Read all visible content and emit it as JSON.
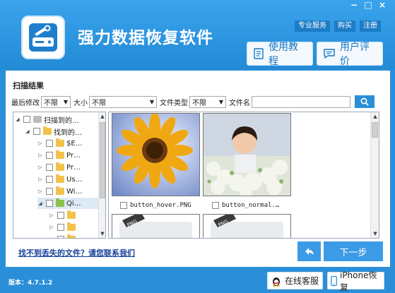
{
  "app": {
    "title": "强力数据恢复软件"
  },
  "window": {
    "minimize": "−",
    "maximize": "□",
    "close": "×"
  },
  "top_links": [
    "专业服务",
    "购买",
    "注册"
  ],
  "header_buttons": {
    "tutorial": "使用教程",
    "review": "用户评价"
  },
  "panel": {
    "title": "扫描结果"
  },
  "filters": {
    "modified_label": "最后修改",
    "modified_value": "不限",
    "size_label": "大小",
    "size_value": "不限",
    "type_label": "文件类型",
    "type_value": "不限",
    "name_label": "文件名",
    "name_value": ""
  },
  "tree": [
    {
      "label": "扫描到的…",
      "icon": "drive"
    },
    {
      "label": "找到的…",
      "icon": "folder"
    },
    {
      "label": "$E…",
      "icon": "folder"
    },
    {
      "label": "Pr…",
      "icon": "folder"
    },
    {
      "label": "Pr…",
      "icon": "folder"
    },
    {
      "label": "Us…",
      "icon": "folder"
    },
    {
      "label": "Wi…",
      "icon": "folder"
    },
    {
      "label": "Qi…",
      "icon": "folder-green"
    },
    {
      "label": "",
      "icon": "folder"
    },
    {
      "label": "",
      "icon": "folder"
    },
    {
      "label": "",
      "icon": "folder"
    },
    {
      "label": "",
      "icon": "folder"
    }
  ],
  "files": [
    {
      "name": "button_hover.PNG",
      "image": "sunflower"
    },
    {
      "name": "button_normal.…",
      "image": "child-photo"
    },
    {
      "name": "",
      "image": "png-placeholder"
    },
    {
      "name": "",
      "image": "png-placeholder"
    }
  ],
  "help": {
    "link": "找不到丢失的文件？请您联系我们"
  },
  "nav": {
    "next": "下一步"
  },
  "footer": {
    "version": "版本：4.7.1.2",
    "support": "在线客服",
    "iphone": "iPhone恢复"
  },
  "colors": {
    "primary": "#2a8fd8",
    "accent_button": "#3c9be6",
    "link": "#14409a"
  }
}
